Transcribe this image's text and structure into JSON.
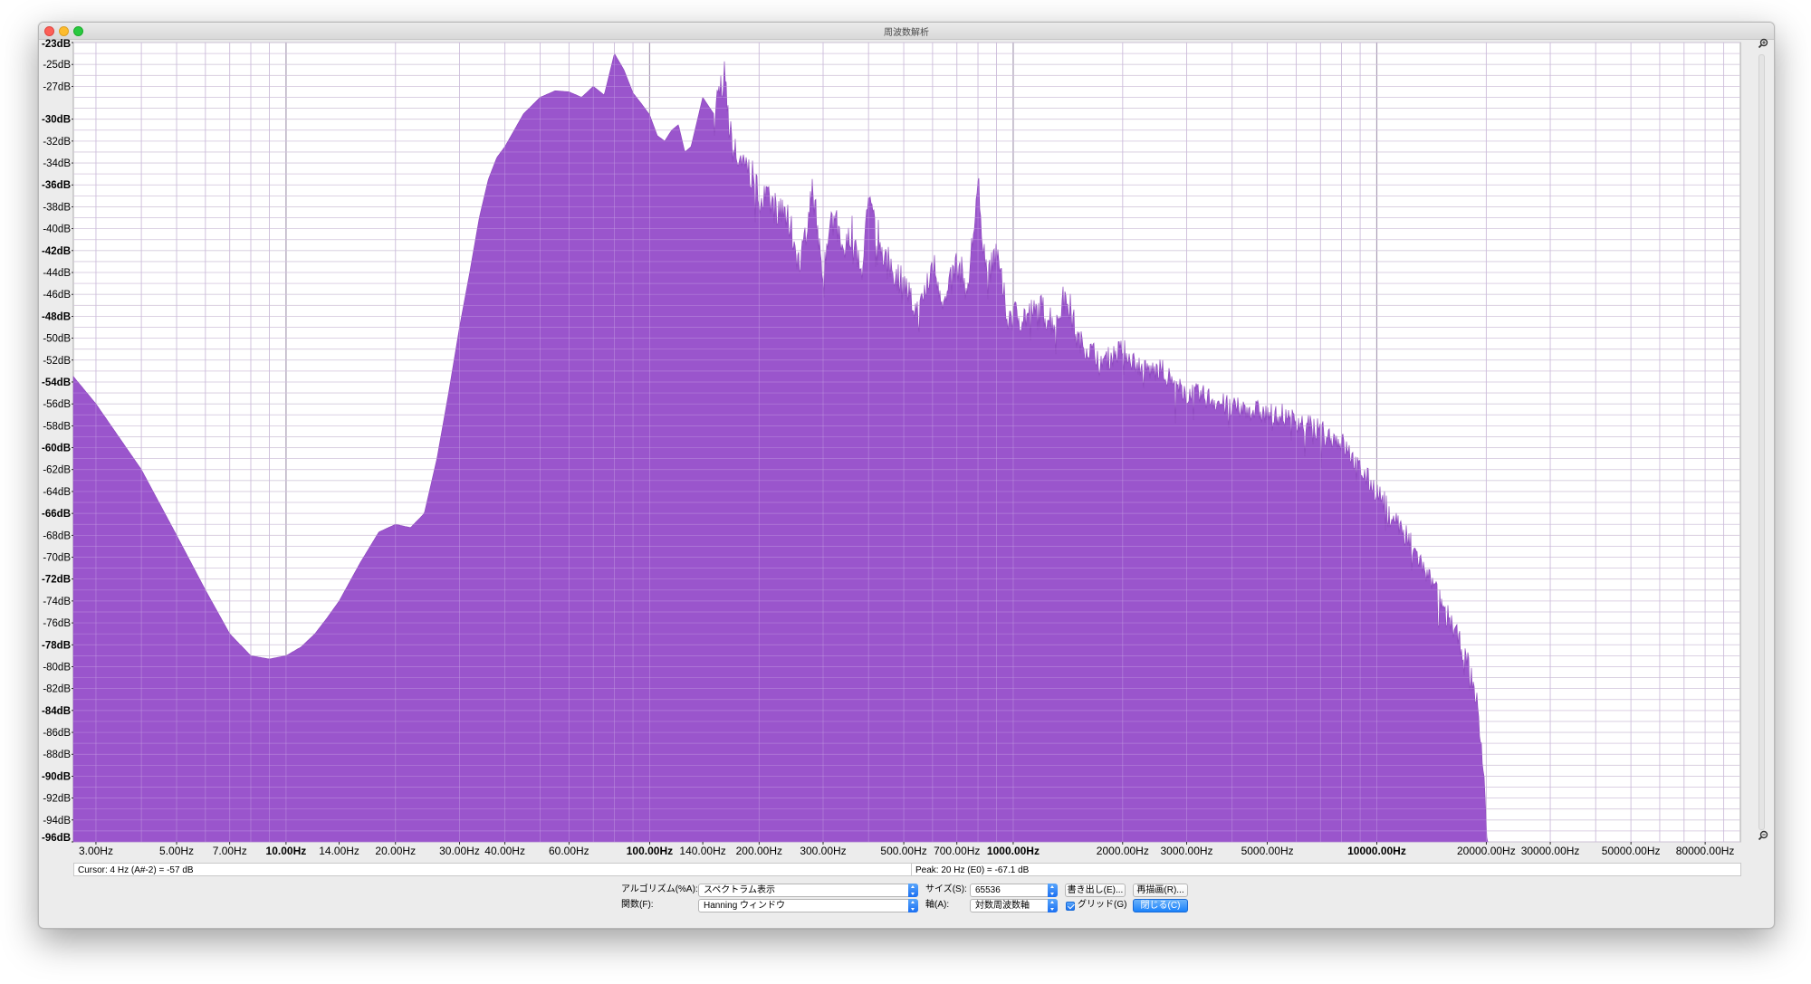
{
  "window": {
    "title": "周波数解析"
  },
  "chart_data": {
    "type": "area",
    "x_scale": "log",
    "xlim": [
      2.6,
      100000
    ],
    "ylim": [
      -96,
      -23
    ],
    "grid": true,
    "fill_color": "#9a55cc",
    "y_ticks": [
      "-23dB",
      "-25dB",
      "-27dB",
      "-30dB",
      "-32dB",
      "-34dB",
      "-36dB",
      "-38dB",
      "-40dB",
      "-42dB",
      "-44dB",
      "-46dB",
      "-48dB",
      "-50dB",
      "-52dB",
      "-54dB",
      "-56dB",
      "-58dB",
      "-60dB",
      "-62dB",
      "-64dB",
      "-66dB",
      "-68dB",
      "-70dB",
      "-72dB",
      "-74dB",
      "-76dB",
      "-78dB",
      "-80dB",
      "-82dB",
      "-84dB",
      "-86dB",
      "-88dB",
      "-90dB",
      "-92dB",
      "-94dB",
      "-96dB"
    ],
    "x_ticks": [
      "3.00Hz",
      "5.00Hz",
      "7.00Hz",
      "10.00Hz",
      "14.00Hz",
      "20.00Hz",
      "30.00Hz",
      "40.00Hz",
      "60.00Hz",
      "100.00Hz",
      "140.00Hz",
      "200.00Hz",
      "300.00Hz",
      "500.00Hz",
      "700.00Hz",
      "1000.00Hz",
      "2000.00Hz",
      "3000.00Hz",
      "5000.00Hz",
      "10000.00Hz",
      "20000.00Hz",
      "30000.00Hz",
      "50000.00Hz",
      "80000.00Hz"
    ],
    "spectrum": {
      "x": [
        2.6,
        3,
        4,
        5,
        6,
        7,
        8,
        9,
        10,
        11,
        12,
        13,
        14,
        16,
        18,
        20,
        22,
        24,
        26,
        28,
        30,
        32,
        34,
        36,
        38,
        40,
        45,
        50,
        55,
        60,
        65,
        70,
        75,
        80,
        85,
        90,
        95,
        100,
        105,
        110,
        115,
        120,
        125,
        130,
        140,
        150,
        160,
        165,
        170,
        180,
        190,
        200,
        220,
        240,
        260,
        280,
        300,
        320,
        340,
        360,
        380,
        400,
        450,
        500,
        550,
        600,
        650,
        700,
        750,
        800,
        850,
        900,
        950,
        1000,
        1100,
        1200,
        1300,
        1400,
        1500,
        1600,
        1800,
        2000,
        2200,
        2400,
        2600,
        2800,
        3000,
        3500,
        4000,
        4500,
        5000,
        5500,
        6000,
        6500,
        7000,
        7500,
        8000,
        9000,
        10000,
        11000,
        12000,
        13000,
        14000,
        15000,
        16000,
        17000,
        18000,
        19000,
        19800,
        20100,
        20300
      ],
      "y": [
        -53.5,
        -56,
        -62,
        -68,
        -73,
        -77,
        -79,
        -79.3,
        -79,
        -78.2,
        -77,
        -75.5,
        -74,
        -70.5,
        -67.7,
        -67,
        -67.3,
        -66,
        -61,
        -55,
        -49,
        -44,
        -39,
        -35.5,
        -33.5,
        -32.5,
        -29.5,
        -28,
        -27.4,
        -27.5,
        -28,
        -27,
        -27.8,
        -24,
        -25.5,
        -27.6,
        -28.6,
        -29.6,
        -31.5,
        -32,
        -31,
        -30.5,
        -33,
        -32.5,
        -28,
        -29.5,
        -25.5,
        -30.5,
        -33,
        -33.5,
        -35,
        -37,
        -38,
        -39,
        -43.5,
        -36,
        -44,
        -38,
        -43,
        -40,
        -44.5,
        -38,
        -43,
        -45,
        -48,
        -43,
        -47,
        -43,
        -45.5,
        -36,
        -45,
        -42,
        -47,
        -48,
        -48,
        -47.5,
        -48.5,
        -46,
        -50,
        -51,
        -52,
        -51,
        -52.5,
        -53,
        -53,
        -54.5,
        -55,
        -55.5,
        -56.5,
        -56.5,
        -57,
        -57,
        -57.5,
        -58,
        -58.5,
        -59,
        -59.5,
        -62,
        -64,
        -66,
        -68,
        -70,
        -72,
        -74,
        -76,
        -78,
        -80,
        -84,
        -91,
        -96,
        -96
      ]
    },
    "cursor_text": "Cursor: 4 Hz (A#-2) = -57 dB",
    "peak_text": "Peak: 20 Hz (E0) = -67.1 dB"
  },
  "controls": {
    "algorithm_label": "アルゴリズム(%A):",
    "algorithm_value": "スペクトラム表示",
    "function_label": "関数(F):",
    "function_value": "Hanning ウィンドウ",
    "size_label": "サイズ(S):",
    "size_value": "65536",
    "axis_label": "軸(A):",
    "axis_value": "対数周波数軸",
    "export_button": "書き出し(E)...",
    "replot_button": "再描画(R)...",
    "grid_label": "グリッド(G)",
    "grid_checked": true,
    "close_button": "閉じる(C)"
  },
  "icons": {
    "zoom_in": "zoom-in-icon",
    "zoom_out": "zoom-out-icon"
  }
}
